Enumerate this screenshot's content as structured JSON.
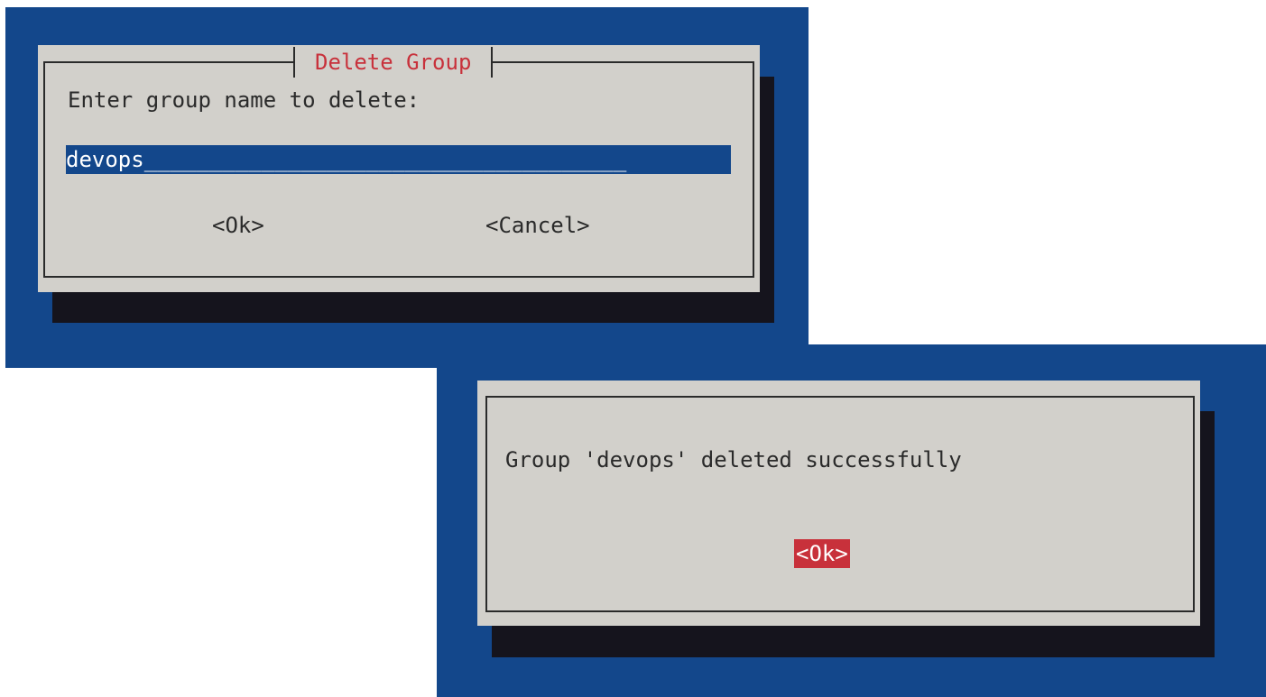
{
  "screen_1": {
    "dialog_title": "Delete Group",
    "prompt": "Enter group name to delete:",
    "input_value": "devops",
    "input_fill": "_____________________________________",
    "ok_label": "<Ok>",
    "cancel_label": "<Cancel>"
  },
  "screen_2": {
    "message": "Group 'devops' deleted successfully",
    "ok_label": "<Ok>"
  },
  "colors": {
    "terminal_background": "#13478b",
    "dialog_background": "#d2d0cb",
    "dialog_shadow": "#15141d",
    "title_text": "#c8313b",
    "focused_button": "#c8313b",
    "input_background": "#13478b"
  }
}
